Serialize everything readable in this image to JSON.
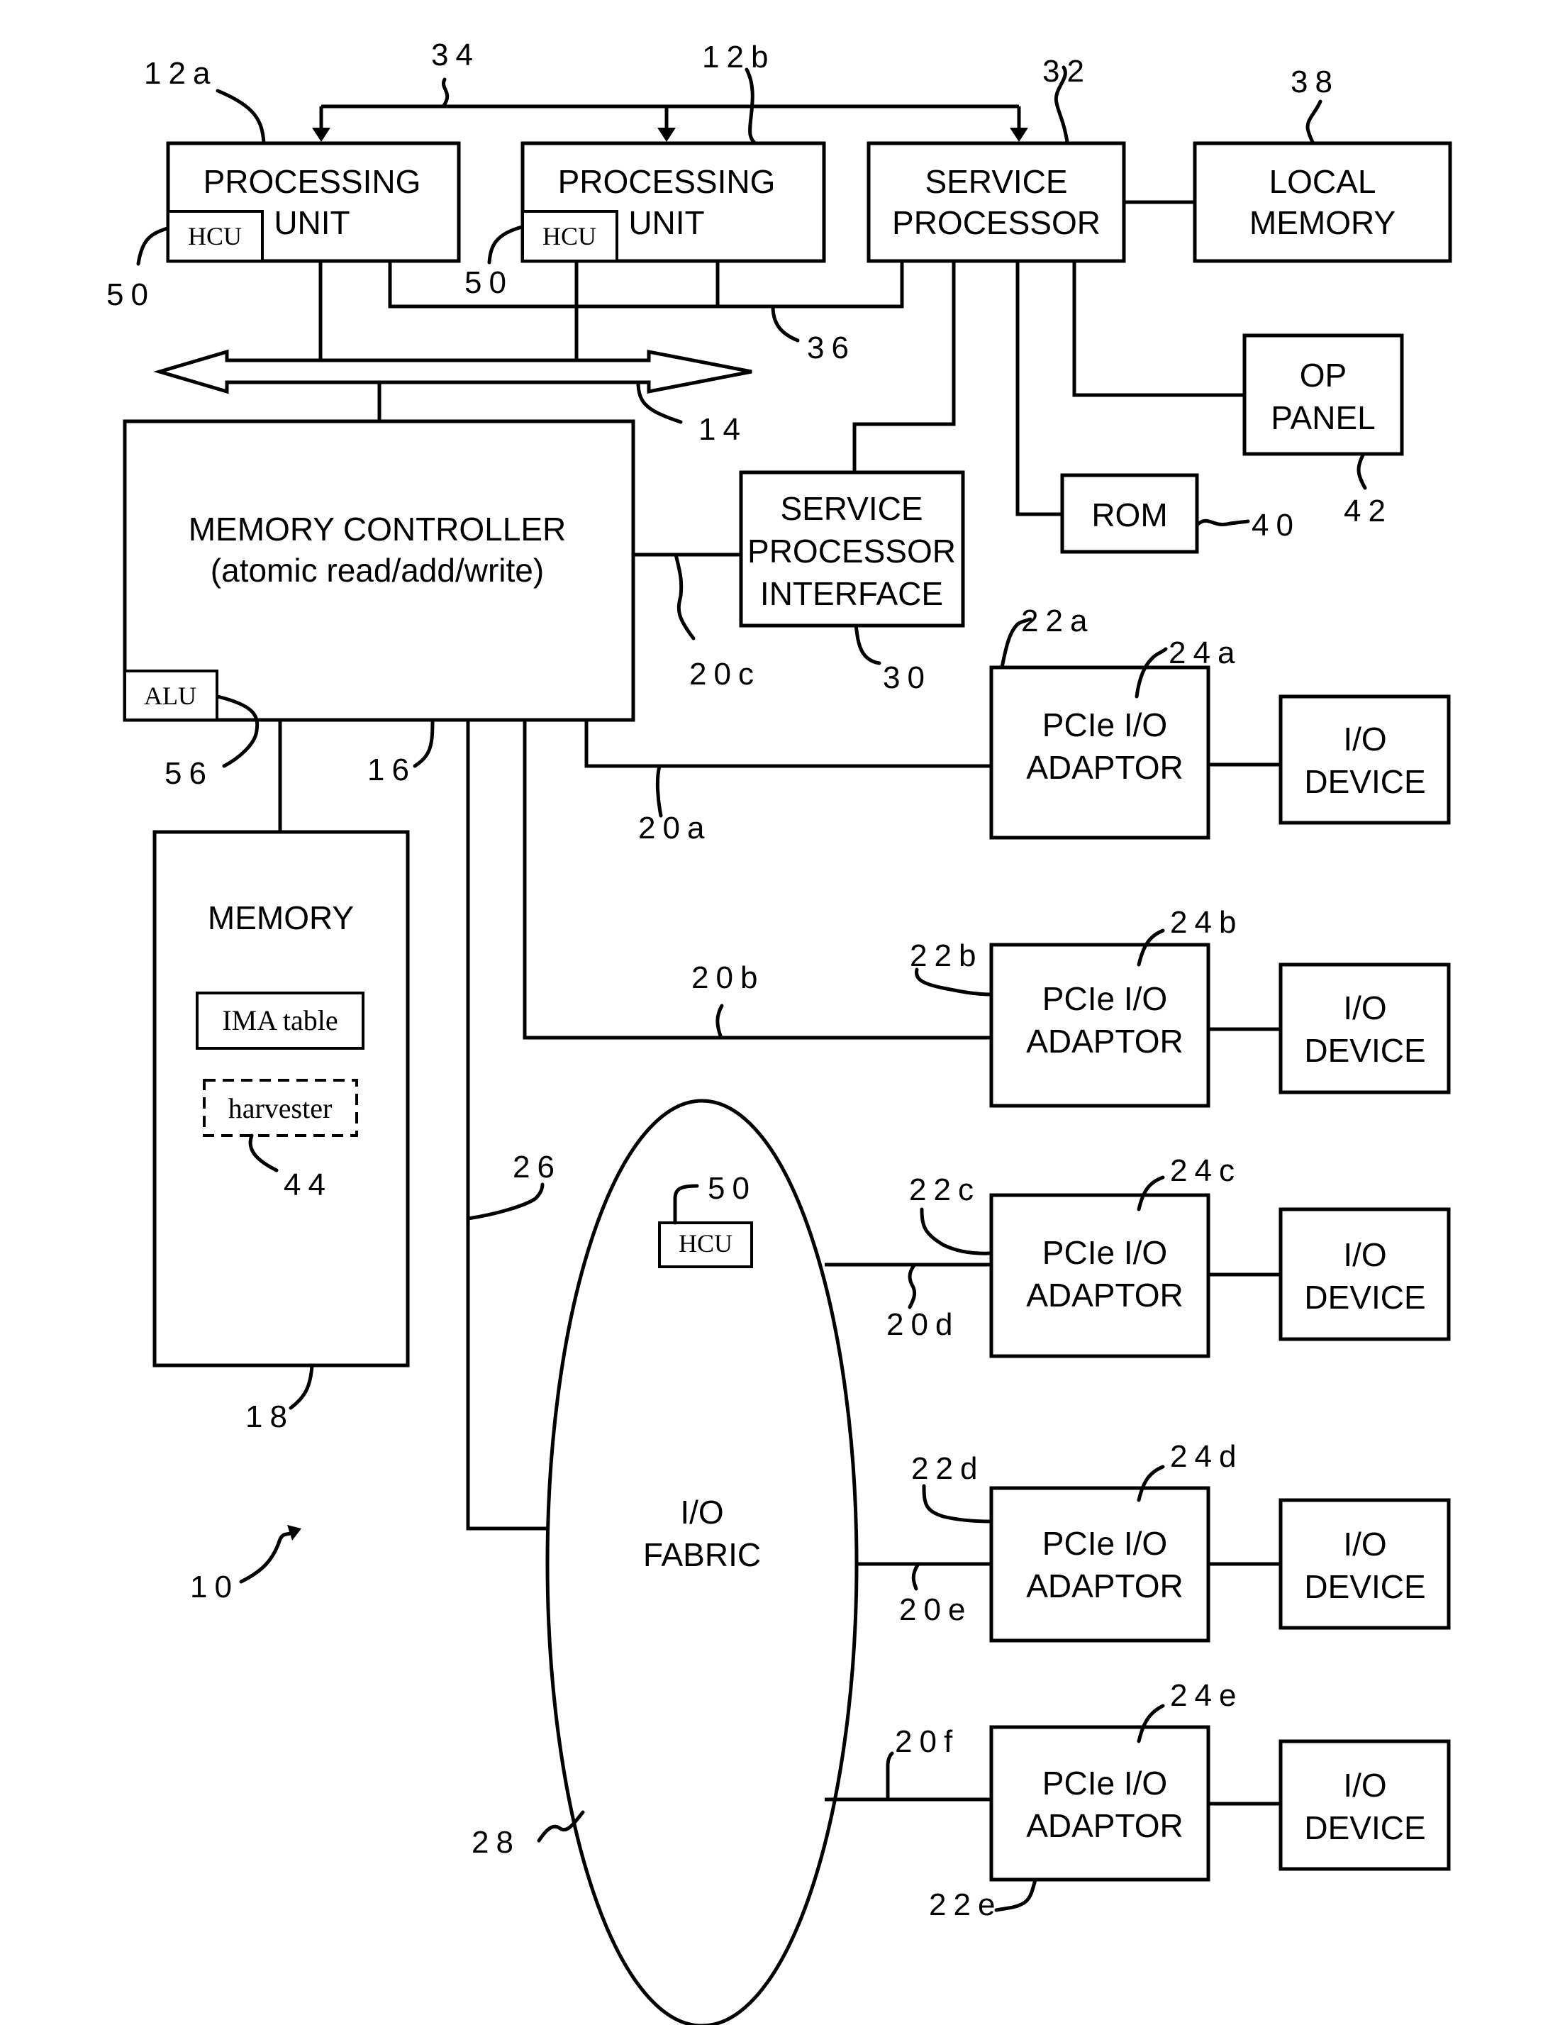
{
  "figure": {
    "reference": "10",
    "blocks": {
      "pu_a": {
        "line1": "PROCESSING",
        "line2": "UNIT",
        "ref": "12a",
        "hcu": "HCU",
        "hcu_ref": "50"
      },
      "pu_b": {
        "line1": "PROCESSING",
        "line2": "UNIT",
        "ref": "12b",
        "hcu": "HCU",
        "hcu_ref": "50"
      },
      "service_processor": {
        "line1": "SERVICE",
        "line2": "PROCESSOR",
        "ref": "32"
      },
      "local_memory": {
        "line1": "LOCAL",
        "line2": "MEMORY",
        "ref": "38"
      },
      "op_panel": {
        "line1": "OP",
        "line2": "PANEL",
        "ref": "42"
      },
      "rom": {
        "label": "ROM",
        "ref": "40"
      },
      "memory_controller": {
        "line1": "MEMORY CONTROLLER",
        "line2": "(atomic read/add/write)",
        "ref": "16",
        "alu": "ALU",
        "alu_ref": "56"
      },
      "sp_interface": {
        "line1": "SERVICE",
        "line2": "PROCESSOR",
        "line3": "INTERFACE",
        "ref": "30"
      },
      "memory": {
        "title": "MEMORY",
        "table": "IMA table",
        "harvester": "harvester",
        "harvester_ref": "44",
        "ref": "18"
      },
      "io_fabric": {
        "line1": "I/O",
        "line2": "FABRIC",
        "ref": "28",
        "hcu": "HCU",
        "hcu_ref": "50"
      }
    },
    "buses": {
      "sp_bus": "34",
      "sp_bus2": "36",
      "system_bus": "14",
      "fabric_link": "26"
    },
    "adaptors": [
      {
        "line1": "PCIe I/O",
        "line2": "ADAPTOR",
        "ref": "22a",
        "link": "20a",
        "device_line1": "I/O",
        "device_line2": "DEVICE",
        "device_ref": "24a"
      },
      {
        "line1": "PCIe I/O",
        "line2": "ADAPTOR",
        "ref": "22b",
        "link": "20b",
        "device_line1": "I/O",
        "device_line2": "DEVICE",
        "device_ref": "24b"
      },
      {
        "line1": "PCIe I/O",
        "line2": "ADAPTOR",
        "ref": "22c",
        "link": "20d",
        "device_line1": "I/O",
        "device_line2": "DEVICE",
        "device_ref": "24c"
      },
      {
        "line1": "PCIe I/O",
        "line2": "ADAPTOR",
        "ref": "22d",
        "link": "20e",
        "device_line1": "I/O",
        "device_line2": "DEVICE",
        "device_ref": "24d"
      },
      {
        "line1": "PCIe I/O",
        "line2": "ADAPTOR",
        "ref": "22e",
        "link": "20f",
        "device_line1": "I/O",
        "device_line2": "DEVICE",
        "device_ref": "24e"
      }
    ],
    "spi_link": "20c"
  }
}
